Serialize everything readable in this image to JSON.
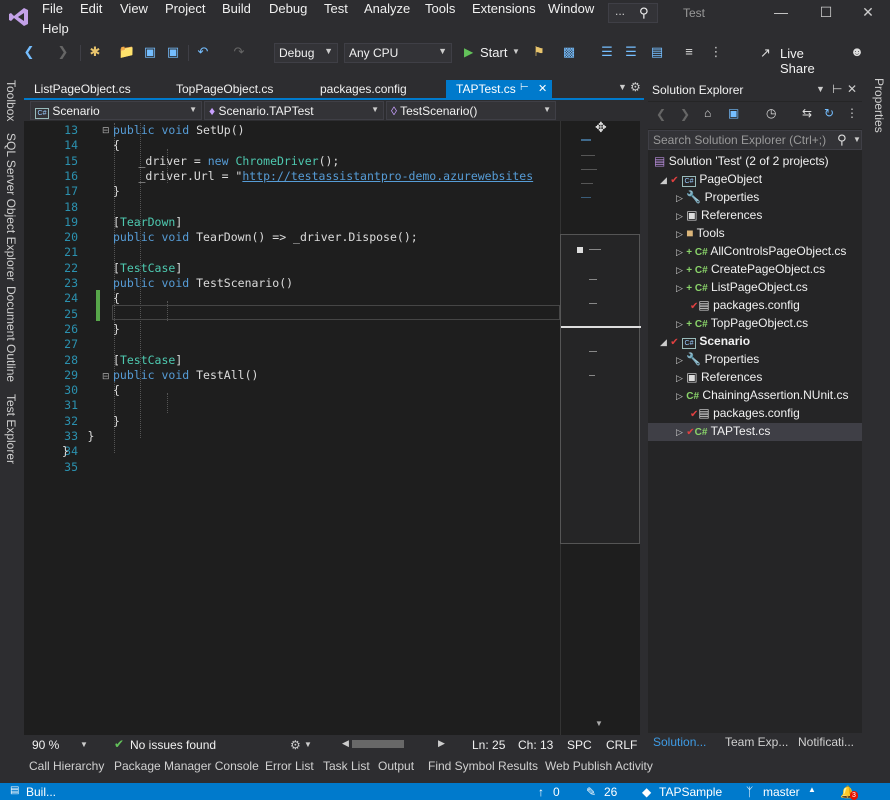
{
  "menu": {
    "items": [
      "File",
      "Edit",
      "View",
      "Project",
      "Build",
      "Debug",
      "Test",
      "Analyze",
      "Tools",
      "Extensions",
      "Window",
      "Help"
    ],
    "overflow": "...",
    "window_title": "Test"
  },
  "toolbar": {
    "config": "Debug",
    "platform": "Any CPU",
    "start_label": "Start",
    "live_share": "Live Share"
  },
  "left_tabs": [
    "Toolbox",
    "SQL Server Object Explorer",
    "Document Outline",
    "Test Explorer"
  ],
  "right_tabs": [
    "Properties"
  ],
  "doc_tabs": [
    {
      "label": "ListPageObject.cs",
      "active": false
    },
    {
      "label": "TopPageObject.cs",
      "active": false
    },
    {
      "label": "packages.config",
      "active": false
    },
    {
      "label": "TAPTest.cs",
      "active": true
    }
  ],
  "nav": {
    "project": "Scenario",
    "type": "Scenario.TAPTest",
    "member": "TestScenario()"
  },
  "code_lines": [
    {
      "n": "13",
      "text": "public void SetUp()"
    },
    {
      "n": "14",
      "text": "{"
    },
    {
      "n": "15",
      "text": "_driver = new ChromeDriver();"
    },
    {
      "n": "16",
      "text": "_driver.Url = \"http://testassistantpro-demo.azurewebsites"
    },
    {
      "n": "17",
      "text": "}"
    },
    {
      "n": "18",
      "text": ""
    },
    {
      "n": "19",
      "text": "[TearDown]"
    },
    {
      "n": "20",
      "text": "public void TearDown() => _driver.Dispose();"
    },
    {
      "n": "21",
      "text": ""
    },
    {
      "n": "22",
      "text": "[TestCase]"
    },
    {
      "n": "23",
      "text": "public void TestScenario()"
    },
    {
      "n": "24",
      "text": "{"
    },
    {
      "n": "25",
      "text": ""
    },
    {
      "n": "26",
      "text": "}"
    },
    {
      "n": "27",
      "text": ""
    },
    {
      "n": "28",
      "text": "[TestCase]"
    },
    {
      "n": "29",
      "text": "public void TestAll()"
    },
    {
      "n": "30",
      "text": "{"
    },
    {
      "n": "31",
      "text": ""
    },
    {
      "n": "32",
      "text": "}"
    },
    {
      "n": "33",
      "text": "}"
    },
    {
      "n": "34",
      "text": "}"
    },
    {
      "n": "35",
      "text": ""
    }
  ],
  "editor_status": {
    "zoom": "90 %",
    "issues": "No issues found",
    "line": "Ln: 25",
    "col": "Ch: 13",
    "spc": "SPC",
    "crlf": "CRLF"
  },
  "solution_explorer": {
    "title": "Solution Explorer",
    "search_placeholder": "Search Solution Explorer (Ctrl+;)",
    "solution": "Solution 'Test' (2 of 2 projects)",
    "projects": [
      {
        "name": "PageObject",
        "items": [
          "Properties",
          "References",
          "Tools",
          "AllControlsPageObject.cs",
          "CreatePageObject.cs",
          "ListPageObject.cs",
          "packages.config",
          "TopPageObject.cs"
        ]
      },
      {
        "name": "Scenario",
        "items": [
          "Properties",
          "References",
          "ChainingAssertion.NUnit.cs",
          "packages.config",
          "TAPTest.cs"
        ]
      }
    ],
    "tabs": [
      "Solution...",
      "Team Exp...",
      "Notificati..."
    ]
  },
  "bottom_tabs": [
    "Call Hierarchy",
    "Package Manager Console",
    "Error List",
    "Task List",
    "Output",
    "Find Symbol Results",
    "Web Publish Activity"
  ],
  "status": {
    "left": "Buil...",
    "up": "0",
    "pencil": "26",
    "repo": "TAPSample",
    "branch": "master",
    "notifications": "3"
  },
  "colors": {
    "accent": "#007acc",
    "keyword": "#569cd6",
    "type": "#4ec9b0",
    "linenumber": "#2b91af",
    "change_bar": "#57a64a"
  }
}
